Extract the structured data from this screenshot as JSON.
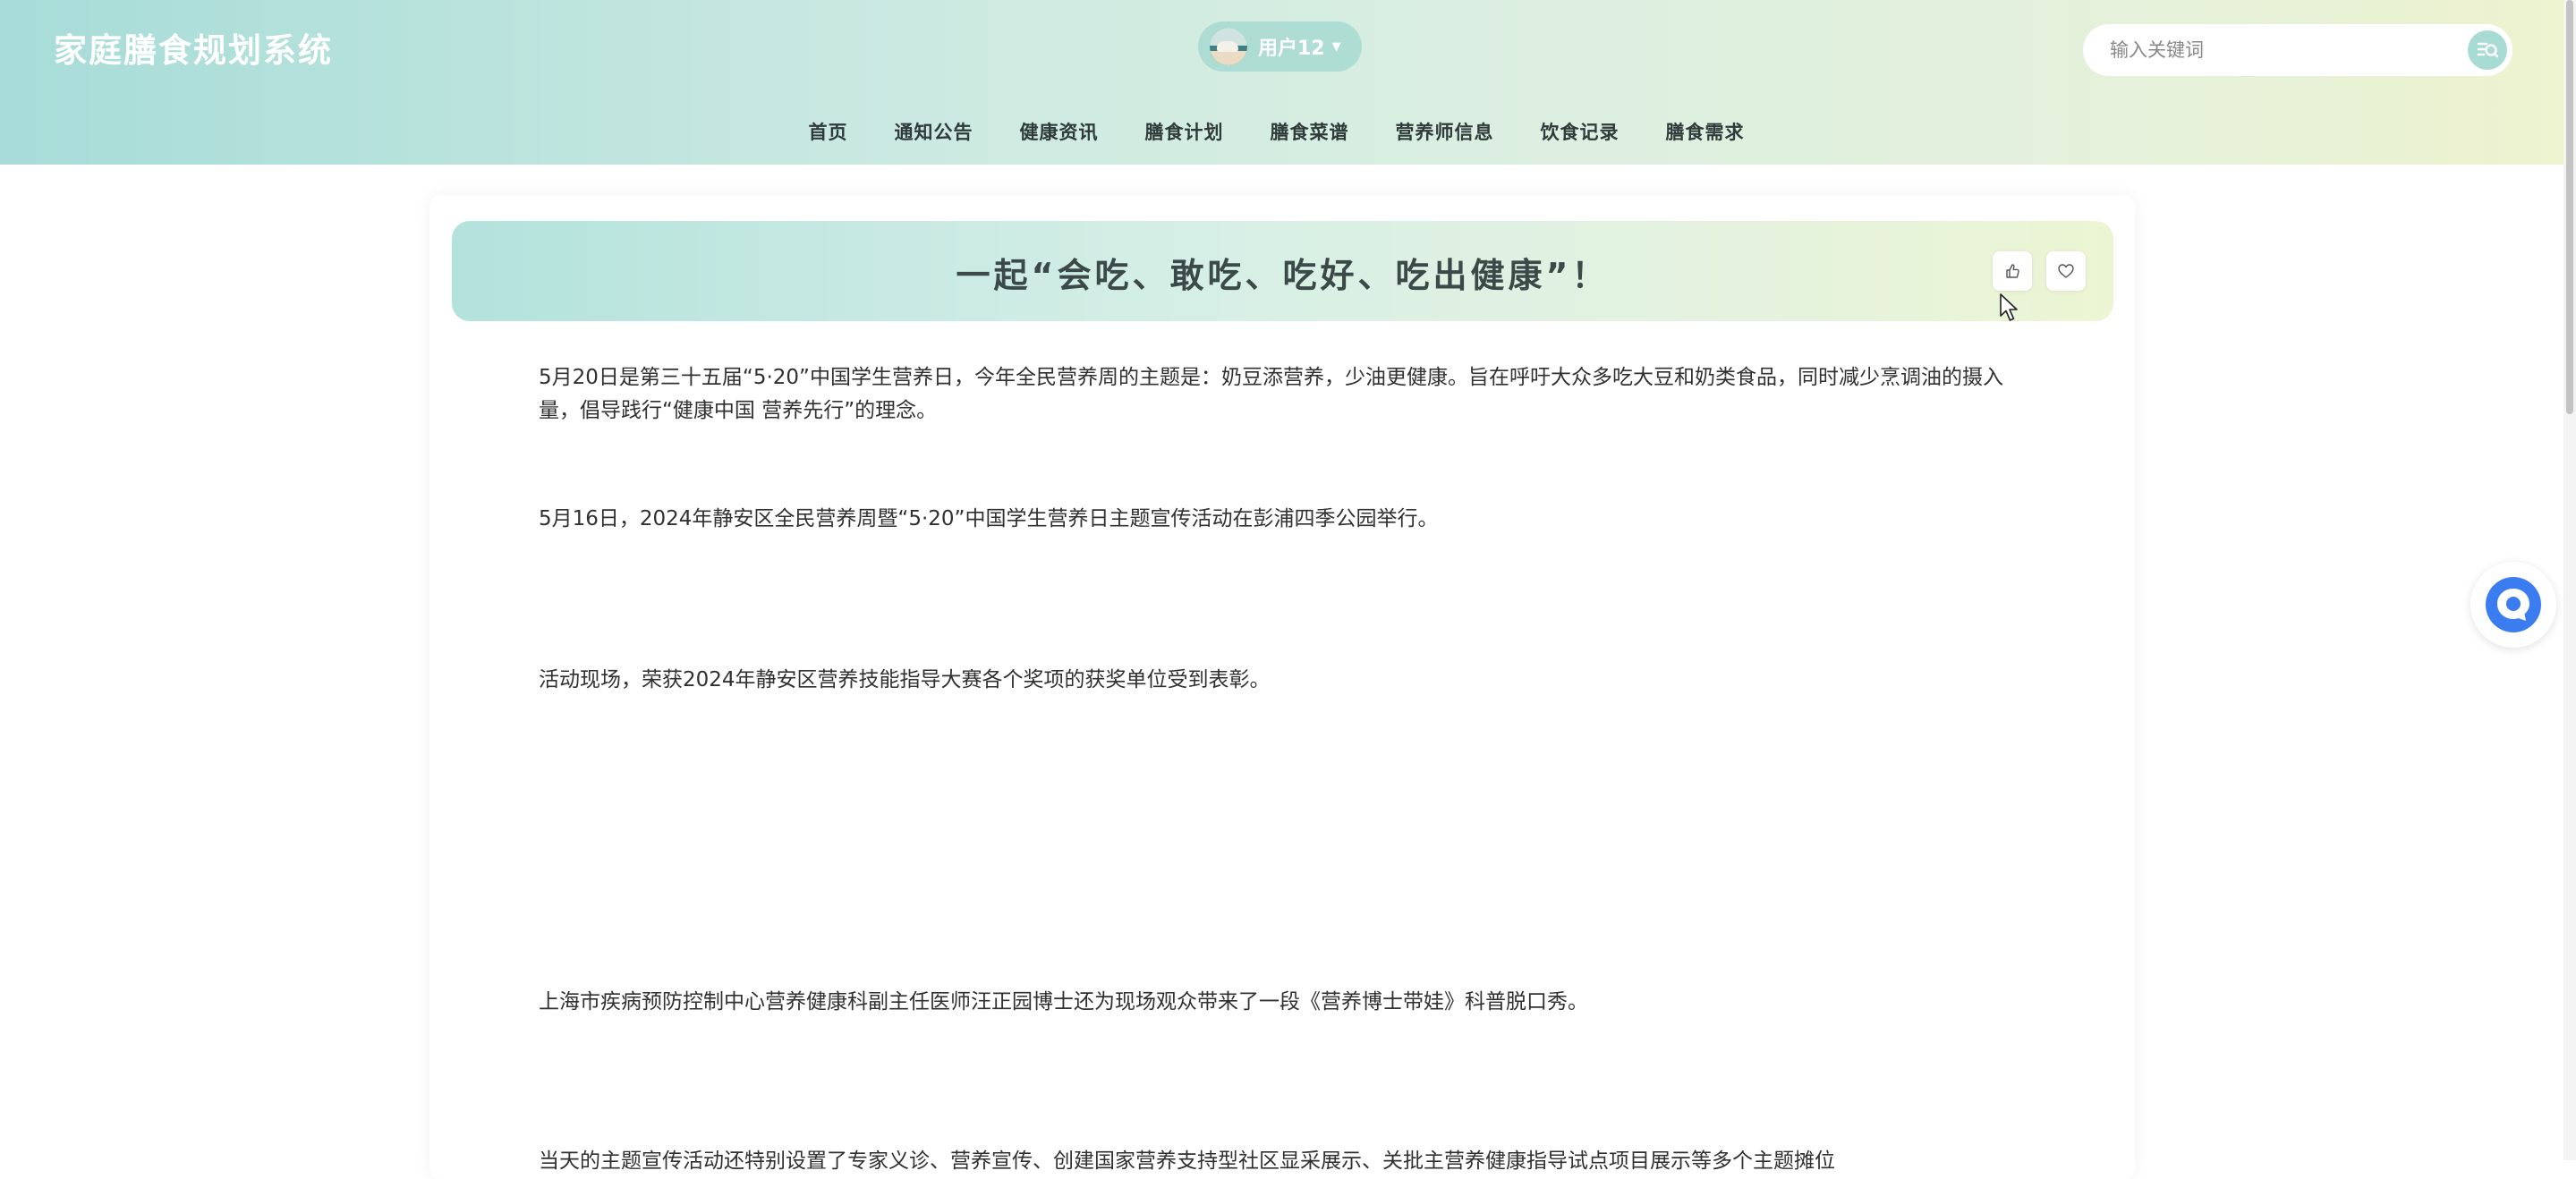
{
  "app": {
    "title": "家庭膳食规划系统"
  },
  "user": {
    "name": "用户12"
  },
  "search": {
    "placeholder": "输入关键词"
  },
  "nav": {
    "items": [
      "首页",
      "通知公告",
      "健康资讯",
      "膳食计划",
      "膳食菜谱",
      "营养师信息",
      "饮食记录",
      "膳食需求"
    ]
  },
  "article": {
    "title": "一起“会吃、敢吃、吃好、吃出健康”！",
    "paragraphs": [
      "5月20日是第三十五届“5·20”中国学生营养日，今年全民营养周的主题是：奶豆添营养，少油更健康。旨在呼吁大众多吃大豆和奶类食品，同时减少烹调油的摄入量，倡导践行“健康中国 营养先行”的理念。",
      "5月16日，2024年静安区全民营养周暨“5·20”中国学生营养日主题宣传活动在彭浦四季公园举行。",
      "活动现场，荣获2024年静安区营养技能指导大赛各个奖项的获奖单位受到表彰。",
      "上海市疾病预防控制中心营养健康科副主任医师汪正园博士还为现场观众带来了一段《营养博士带娃》科普脱口秀。",
      "当天的主题宣传活动还特别设置了专家义诊、营养宣传、创建国家营养支持型社区显采展示、关批主营养健康指导试点项目展示等多个主题摊位"
    ]
  },
  "icons": {
    "like": "thumbs-up-icon",
    "favorite": "heart-icon",
    "search": "search-icon",
    "chat": "chat-icon",
    "caret": "chevron-down-icon"
  },
  "colors": {
    "header_start": "#a7dcd8",
    "header_end": "#eef3cf",
    "chat_accent": "#3b7cf0"
  }
}
